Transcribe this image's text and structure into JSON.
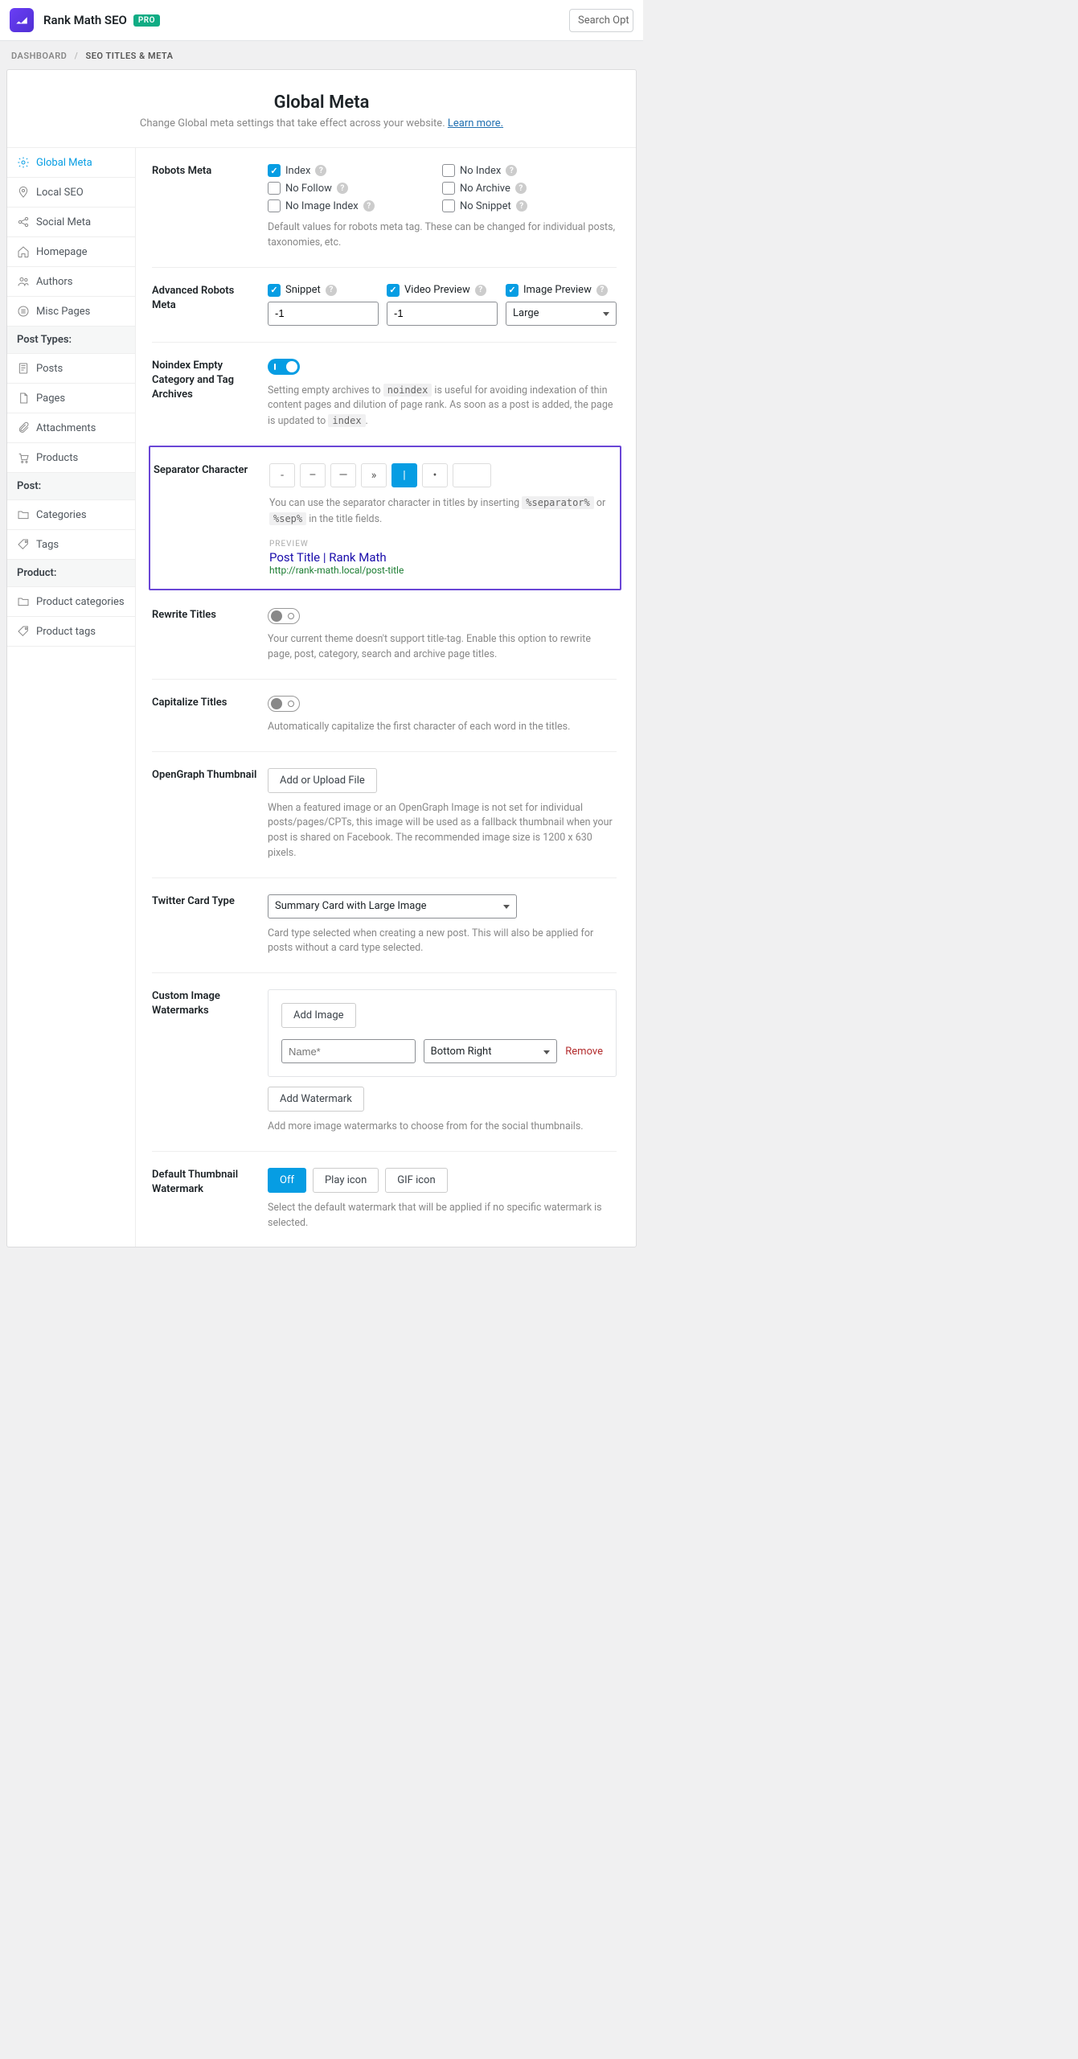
{
  "header": {
    "app_title": "Rank Math SEO",
    "pro_badge": "PRO",
    "search_placeholder": "Search Opt"
  },
  "breadcrumb": {
    "root": "DASHBOARD",
    "current": "SEO TITLES & META"
  },
  "page": {
    "title": "Global Meta",
    "subtitle": "Change Global meta settings that take effect across your website. ",
    "learn_more": "Learn more."
  },
  "sidebar": {
    "items": [
      "Global Meta",
      "Local SEO",
      "Social Meta",
      "Homepage",
      "Authors",
      "Misc Pages"
    ],
    "group_post_types": "Post Types:",
    "post_types": [
      "Posts",
      "Pages",
      "Attachments",
      "Products"
    ],
    "group_post": "Post:",
    "post_tax": [
      "Categories",
      "Tags"
    ],
    "group_product": "Product:",
    "product_tax": [
      "Product categories",
      "Product tags"
    ]
  },
  "robots_meta": {
    "label": "Robots Meta",
    "options": [
      "Index",
      "No Index",
      "No Follow",
      "No Archive",
      "No Image Index",
      "No Snippet"
    ],
    "hint": "Default values for robots meta tag. These can be changed for individual posts, taxonomies, etc."
  },
  "advanced_robots": {
    "label": "Advanced Robots Meta",
    "snippet": {
      "label": "Snippet",
      "value": "-1"
    },
    "video": {
      "label": "Video Preview",
      "value": "-1"
    },
    "image": {
      "label": "Image Preview",
      "value": "Large"
    }
  },
  "noindex_empty": {
    "label": "Noindex Empty Category and Tag Archives",
    "hint_pre": "Setting empty archives to ",
    "hint_code1": "noindex",
    "hint_mid": " is useful for avoiding indexation of thin content pages and dilution of page rank. As soon as a post is added, the page is updated to ",
    "hint_code2": "index",
    "hint_end": "."
  },
  "separator": {
    "label": "Separator Character",
    "options": [
      "-",
      "–",
      "—",
      "»",
      "|",
      "•",
      ""
    ],
    "hint_pre": "You can use the separator character in titles by inserting ",
    "hint_code1": "%separator%",
    "hint_mid": " or ",
    "hint_code2": "%sep%",
    "hint_end": " in the title fields.",
    "preview_label": "PREVIEW",
    "preview_title": "Post Title | Rank Math",
    "preview_url": "http://rank-math.local/post-title"
  },
  "rewrite_titles": {
    "label": "Rewrite Titles",
    "hint": "Your current theme doesn't support title-tag. Enable this option to rewrite page, post, category, search and archive page titles."
  },
  "capitalize": {
    "label": "Capitalize Titles",
    "hint": "Automatically capitalize the first character of each word in the titles."
  },
  "og_thumb": {
    "label": "OpenGraph Thumbnail",
    "button": "Add or Upload File",
    "hint": "When a featured image or an OpenGraph Image is not set for individual posts/pages/CPTs, this image will be used as a fallback thumbnail when your post is shared on Facebook. The recommended image size is 1200 x 630 pixels."
  },
  "twitter": {
    "label": "Twitter Card Type",
    "value": "Summary Card with Large Image",
    "hint": "Card type selected when creating a new post. This will also be applied for posts without a card type selected."
  },
  "watermarks": {
    "label": "Custom Image Watermarks",
    "add_image": "Add Image",
    "name_placeholder": "Name*",
    "position": "Bottom Right",
    "remove": "Remove",
    "add_watermark": "Add Watermark",
    "hint": "Add more image watermarks to choose from for the social thumbnails."
  },
  "default_wm": {
    "label": "Default Thumbnail Watermark",
    "options": [
      "Off",
      "Play icon",
      "GIF icon"
    ],
    "hint": "Select the default watermark that will be applied if no specific watermark is selected."
  }
}
